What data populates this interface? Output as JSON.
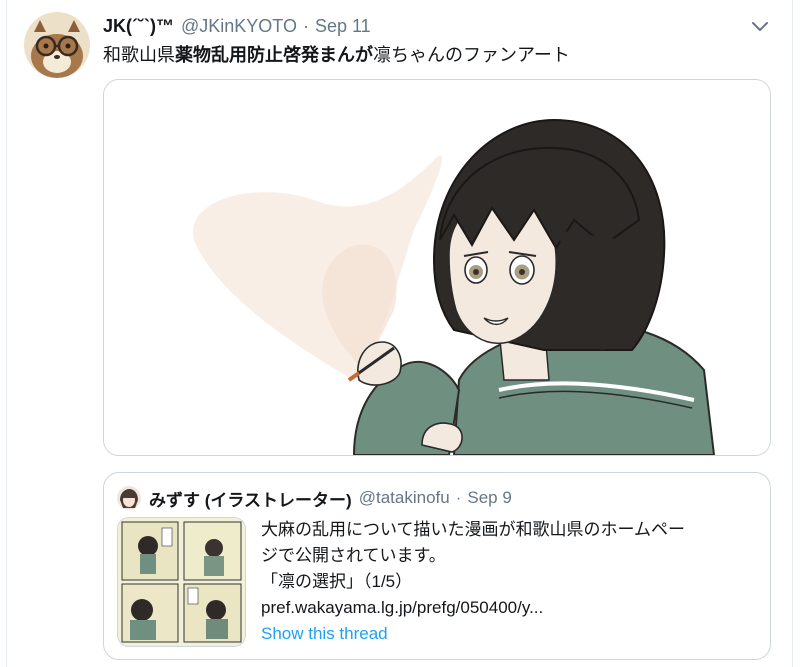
{
  "tweet": {
    "author_name": "JK(´˘`)™",
    "author_handle": "@JKinKYOTO",
    "separator": "·",
    "date": "Sep 11",
    "text_prefix": "和歌山県",
    "text_bold": "薬物乱用防止啓発まんが",
    "text_suffix": "凛ちゃんのファンアート",
    "avatar_icon": "raccoon-with-glasses-avatar",
    "menu_icon": "chevron-down-icon",
    "media_icon": "anime-girl-illustration"
  },
  "quote": {
    "author_name": "みずす (イラストレーター)",
    "author_handle": "@tatakinofu",
    "separator": "·",
    "date": "Sep 9",
    "lines": [
      "大麻の乱用について描いた漫画が和歌山県のホームペー",
      "ジで公開されています。",
      "「凛の選択」（1/5）"
    ],
    "link": "pref.wakayama.lg.jp/prefg/050400/y...",
    "show_thread": "Show this thread",
    "thumbnail_icon": "manga-page-thumbnail"
  },
  "colors": {
    "text_primary": "#14171a",
    "text_secondary": "#657786",
    "link_blue": "#1da1f2",
    "border": "#ccd6dd",
    "jacket": "#6f9080"
  }
}
